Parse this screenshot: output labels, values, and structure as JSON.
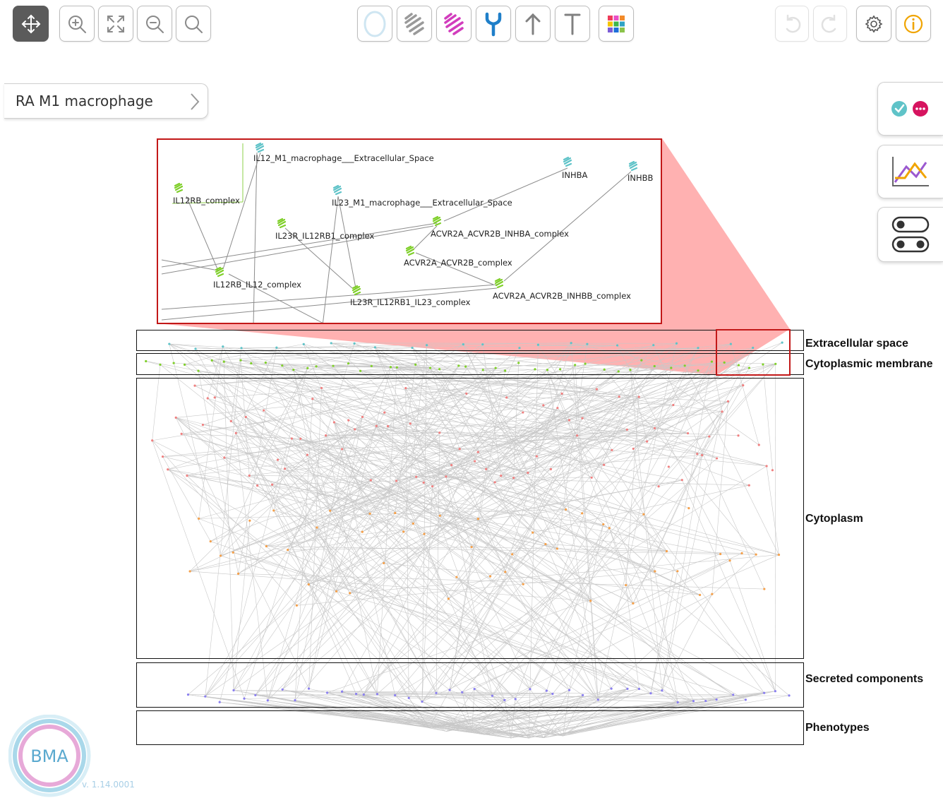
{
  "toolbar": {
    "left": [
      {
        "name": "pan-tool-button",
        "icon": "move-arrows-icon",
        "active": true
      },
      {
        "name": "zoom-in-button",
        "icon": "zoom-in-icon"
      },
      {
        "name": "fit-screen-button",
        "icon": "fit-expand-icon"
      },
      {
        "name": "zoom-out-button",
        "icon": "zoom-out-icon"
      },
      {
        "name": "search-button",
        "icon": "search-icon"
      }
    ],
    "center": [
      {
        "name": "filter-circle-button",
        "icon": "circle-icon",
        "color": "#cfe6f2"
      },
      {
        "name": "filter-gray-receptor-button",
        "icon": "receptor-gray-icon",
        "color": "#9a9a9a"
      },
      {
        "name": "filter-pink-receptor-button",
        "icon": "receptor-pink-icon",
        "color": "#d23dbd"
      },
      {
        "name": "filter-y-receptor-button",
        "icon": "y-receptor-icon",
        "color": "#1f7fc9"
      },
      {
        "name": "arrow-edge-button",
        "icon": "arrow-up-icon",
        "color": "#808080"
      },
      {
        "name": "inhibition-edge-button",
        "icon": "t-bar-icon",
        "color": "#808080"
      },
      {
        "name": "color-palette-button",
        "icon": "palette-grid-icon"
      }
    ],
    "right": [
      {
        "name": "undo-button",
        "icon": "undo-icon",
        "disabled": true
      },
      {
        "name": "redo-button",
        "icon": "redo-icon",
        "disabled": true
      },
      {
        "name": "settings-button",
        "icon": "gear-icon"
      },
      {
        "name": "info-button",
        "icon": "info-icon",
        "color": "#f0a400"
      }
    ]
  },
  "breadcrumb": {
    "label": "RA M1 macrophage"
  },
  "side_tabs": [
    {
      "name": "status-legend-tab",
      "icon": "check-and-more-icon"
    },
    {
      "name": "chart-tab",
      "icon": "line-chart-icon"
    },
    {
      "name": "toggles-tab",
      "icon": "toggle-switches-icon"
    }
  ],
  "compartments": [
    {
      "label": "Extracellular space"
    },
    {
      "label": "Cytoplasmic membrane"
    },
    {
      "label": "Cytoplasm"
    },
    {
      "label": "Secreted components"
    },
    {
      "label": "Phenotypes"
    }
  ],
  "zoom_panel": {
    "nodes": [
      "IL12_M1_macrophage___Extracellular_Space",
      "INHBA",
      "INHBB",
      "IL12RB_complex",
      "IL23_M1_macrophage___Extracellular_Space",
      "IL23R_IL12RB1_complex",
      "ACVR2A_ACVR2B_INHBA_complex",
      "ACVR2A_ACVR2B_complex",
      "IL12RB_IL12_complex",
      "IL23R_IL12RB1_IL23_complex",
      "ACVR2A_ACVR2B_INHBB_complex"
    ]
  },
  "logo": {
    "text": "BMA",
    "version": "v. 1.14.0001"
  },
  "colors": {
    "highlight_red": "#c21818",
    "zoom_fill": "#ff9d9d",
    "node_green": "#7fcf2a",
    "node_teal": "#5fc3c8",
    "node_red": "#f08080",
    "node_orange": "#f5a04a",
    "node_purple": "#8a7ff0"
  }
}
